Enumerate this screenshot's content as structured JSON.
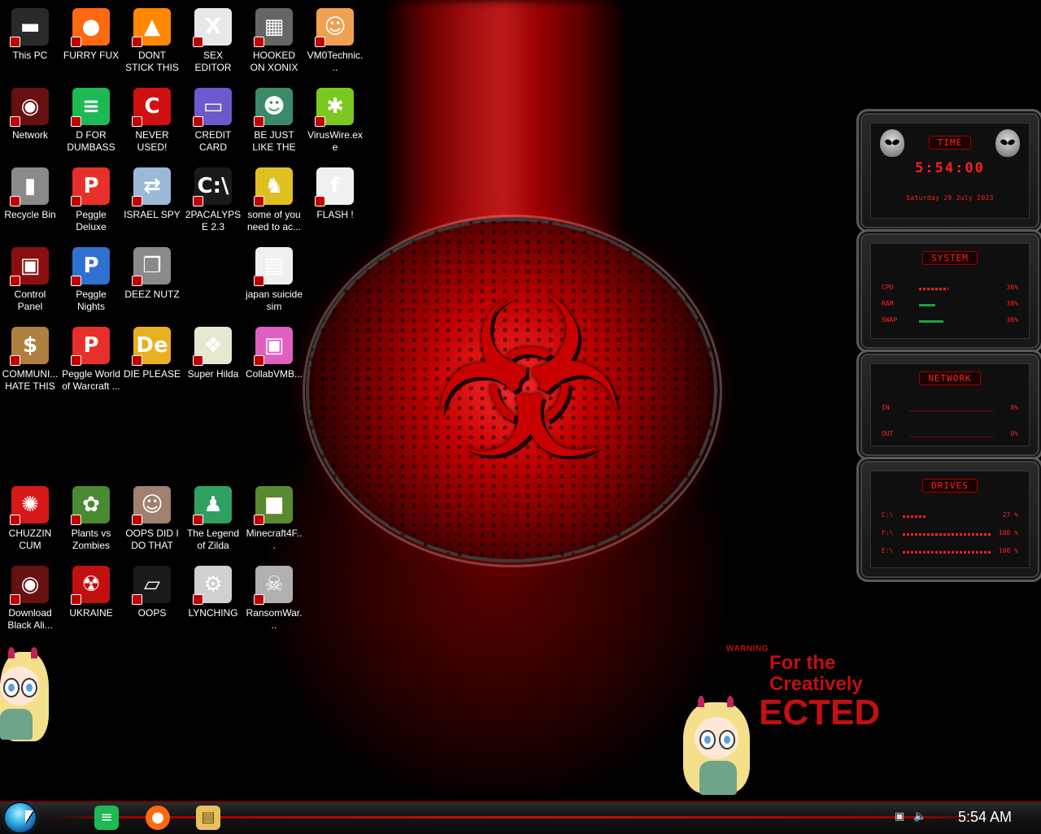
{
  "desktop": {
    "icons": [
      {
        "label": "This PC",
        "icon": "computer-icon",
        "color": "#2a2a2a",
        "glyph": "▬"
      },
      {
        "label": "FURRY FUX",
        "icon": "firefox-icon",
        "color": "#ff6a10",
        "glyph": "●"
      },
      {
        "label": "DONT STICK THIS IN YO...",
        "icon": "vlc-cone-icon",
        "color": "#ff8800",
        "glyph": "▲"
      },
      {
        "label": "SEX EDITOR",
        "icon": "hxd-icon",
        "color": "#e8e8e8",
        "glyph": "X"
      },
      {
        "label": "HOOKED ON XONIX",
        "icon": "xonix-icon",
        "color": "#666666",
        "glyph": "▦"
      },
      {
        "label": "VM0Technic...",
        "icon": "doctor-icon",
        "color": "#f0a050",
        "glyph": "☺"
      },
      {
        "label": "Network",
        "icon": "network-alien-icon",
        "color": "#661010",
        "glyph": "◉"
      },
      {
        "label": "D FOR DUMBASS",
        "icon": "chat-icon",
        "color": "#1db954",
        "glyph": "≡"
      },
      {
        "label": "NEVER USED!",
        "icon": "devcpp-icon",
        "color": "#d01010",
        "glyph": "C"
      },
      {
        "label": "CREDIT CARD CHECKER",
        "icon": "credit-card-icon",
        "color": "#6a5acd",
        "glyph": "▭"
      },
      {
        "label": "BE JUST LIKE THE DUDE!",
        "icon": "santa-icon",
        "color": "#3a8a6a",
        "glyph": "☻"
      },
      {
        "label": "VirusWire.exe",
        "icon": "lime-icon",
        "color": "#7ac820",
        "glyph": "✱"
      },
      {
        "label": "Recycle Bin",
        "icon": "recycle-bin-icon",
        "color": "#8a8a8a",
        "glyph": "▮"
      },
      {
        "label": "Peggle Deluxe",
        "icon": "peggle-icon",
        "color": "#e8302a",
        "glyph": "P"
      },
      {
        "label": "ISRAEL SPY",
        "icon": "spy-network-icon",
        "color": "#9ab8d8",
        "glyph": "⇄"
      },
      {
        "label": "2PACALYPSE 2.3",
        "icon": "terminal-icon",
        "color": "#1a1a1a",
        "glyph": "C:\\"
      },
      {
        "label": "some of you need to ac...",
        "icon": "dog-icon",
        "color": "#e0c020",
        "glyph": "♞"
      },
      {
        "label": "FLASH !",
        "icon": "flash-icon",
        "color": "#f0f0f0",
        "glyph": "f"
      },
      {
        "label": "Control Panel",
        "icon": "control-panel-icon",
        "color": "#8a1010",
        "glyph": "▣"
      },
      {
        "label": "Peggle Nights Deluxe",
        "icon": "peggle-nights-icon",
        "color": "#3070d0",
        "glyph": "P"
      },
      {
        "label": "DEEZ NUTZ",
        "icon": "stack-windows-icon",
        "color": "#8a8a8a",
        "glyph": "❐"
      },
      {
        "label": "",
        "icon": "",
        "color": "",
        "glyph": ""
      },
      {
        "label": "japan suicide sim",
        "icon": "file-icon",
        "color": "#f0f0f0",
        "glyph": "▤"
      },
      {
        "label": "",
        "icon": "",
        "color": "",
        "glyph": ""
      },
      {
        "label": "COMMUNI... HATE THIS ...",
        "icon": "money-bag-icon",
        "color": "#b08040",
        "glyph": "$"
      },
      {
        "label": "Peggle World of Warcraft ...",
        "icon": "peggle-wow-icon",
        "color": "#e8302a",
        "glyph": "P"
      },
      {
        "label": "DIE PLEASE",
        "icon": "de-icon",
        "color": "#e8b020",
        "glyph": "De"
      },
      {
        "label": "Super Hilda",
        "icon": "pixel-cat-icon",
        "color": "#e8e8d0",
        "glyph": "❖"
      },
      {
        "label": "CollabVMB...",
        "icon": "collabvm-icon",
        "color": "#e060c0",
        "glyph": "▣"
      },
      {
        "label": "",
        "icon": "",
        "color": "",
        "glyph": ""
      },
      {
        "label": "CHUZZIN CUM",
        "icon": "chuzzle-icon",
        "color": "#d81818",
        "glyph": "✺"
      },
      {
        "label": "Plants vs Zombies",
        "icon": "flower-icon",
        "color": "#4a8a30",
        "glyph": "✿"
      },
      {
        "label": "OOPS DID I DO THAT",
        "icon": "portrait-icon",
        "color": "#a08070",
        "glyph": "☺"
      },
      {
        "label": "The Legend of Zilda",
        "icon": "pixel-hero-icon",
        "color": "#30a060",
        "glyph": "♟"
      },
      {
        "label": "Minecraft4F...",
        "icon": "grass-block-icon",
        "color": "#5a8a30",
        "glyph": "■"
      },
      {
        "label": "",
        "icon": "",
        "color": "",
        "glyph": ""
      },
      {
        "label": "Download Black Ali...",
        "icon": "alien-download-icon",
        "color": "#661010",
        "glyph": "◉"
      },
      {
        "label": "UKRAINE",
        "icon": "radiation-icon",
        "color": "#c01010",
        "glyph": "☢"
      },
      {
        "label": "OOPS",
        "icon": "laptop-icon",
        "color": "#1a1a1a",
        "glyph": "▱"
      },
      {
        "label": "LYNCHING",
        "icon": "gear-flag-icon",
        "color": "#d0d0d0",
        "glyph": "⚙"
      },
      {
        "label": "RansomWar...",
        "icon": "skull-icon",
        "color": "#b0b0b0",
        "glyph": "☠"
      },
      {
        "label": "",
        "icon": "",
        "color": "",
        "glyph": ""
      }
    ]
  },
  "wallpaper": {
    "warning_small": "WARNING",
    "line1": "For the",
    "line2": "Creatively",
    "line3": "ECTED",
    "accent": "#c01010"
  },
  "gadget": {
    "time_title": "TIME",
    "time_value": "5:54:00",
    "date_value": "Saturday 29 July 2023",
    "system_title": "SYSTEM",
    "system_rows": [
      {
        "key": "CPU",
        "value": "36%",
        "level": 0.36
      },
      {
        "key": "RAM",
        "value": "38%",
        "level": 0.38
      },
      {
        "key": "SWAP",
        "value": "36%",
        "level": 0.36
      }
    ],
    "network_title": "NETWORK",
    "network_rows": [
      {
        "key": "IN",
        "value": "0%"
      },
      {
        "key": "OUT",
        "value": "0%"
      }
    ],
    "drives_title": "DRIVES",
    "drive_rows": [
      {
        "key": "C:\\",
        "value": "27 %",
        "level": 0.27
      },
      {
        "key": "F:\\",
        "value": "100 %",
        "level": 1.0
      },
      {
        "key": "E:\\",
        "value": "100 %",
        "level": 1.0
      }
    ]
  },
  "taskbar": {
    "pinned": [
      {
        "name": "chat-app",
        "icon": "chat-icon",
        "glyph": "≡",
        "color": "#1db954"
      },
      {
        "name": "firefox",
        "icon": "firefox-icon",
        "glyph": "●",
        "color": "#ff6a10"
      },
      {
        "name": "explorer",
        "icon": "folder-icon",
        "glyph": "▤",
        "color": "#e8c060"
      }
    ],
    "tray": {
      "network_icon": "network-tray-icon",
      "volume_icon": "volume-icon"
    },
    "clock": "5:54 AM"
  }
}
